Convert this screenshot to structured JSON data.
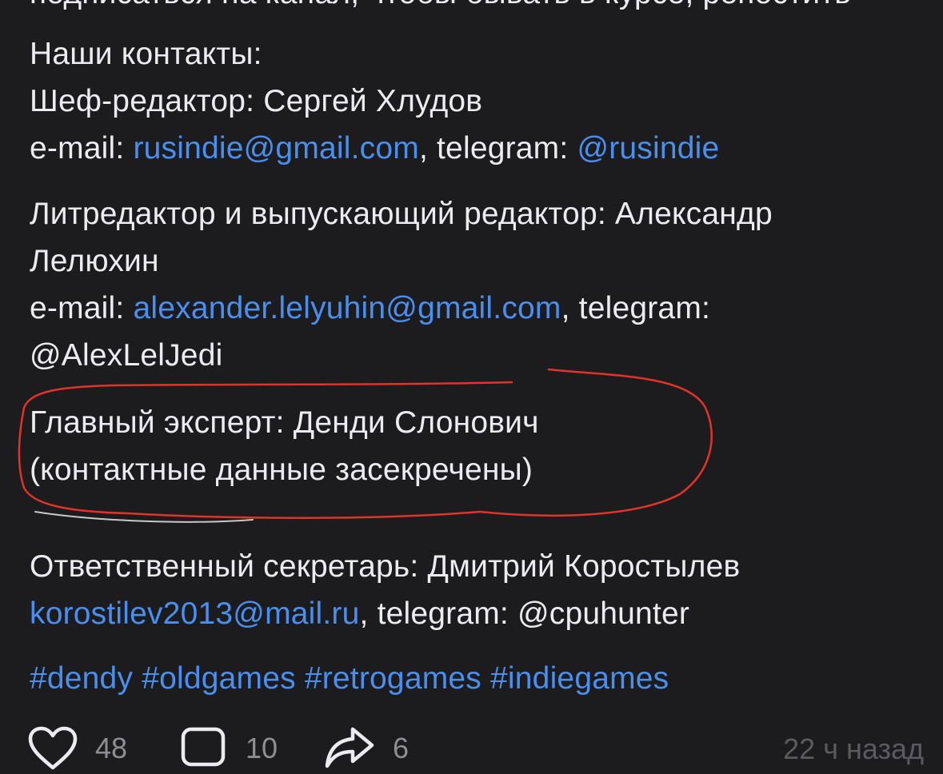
{
  "post": {
    "cut_text": "подписаться на канал, чтобы бывать в курсе, репостить",
    "contacts_heading": "Наши контакты:",
    "chief_editor": "Шеф-редактор: Сергей Хлудов",
    "chief_email_prefix": "e-mail: ",
    "chief_email": "rusindie@gmail.com",
    "chief_tg_prefix": ", telegram: ",
    "chief_tg": "@rusindie",
    "lit_editor_line1": "Литредактор и выпускающий редактор: Александр",
    "lit_editor_line2": "Лелюхин",
    "lit_email_prefix": "e-mail: ",
    "lit_email": "alexander.lelyuhin@gmail.com",
    "lit_tg_prefix": ", telegram:",
    "lit_tg": "@AlexLelJedi",
    "expert_line1": "Главный эксперт: Денди Слонович",
    "expert_line2": "(контактные данные засекречены)",
    "secretary": "Ответственный секретарь: Дмитрий Коростылев",
    "secretary_email": "korostilev2013@mail.ru",
    "secretary_tg_prefix": ", telegram: @cpuhunter",
    "hashtags": [
      "#dendy",
      "#oldgames",
      "#retrogames",
      "#indiegames"
    ]
  },
  "actions": {
    "likes": "48",
    "comments": "10",
    "shares": "6",
    "time": "22 ч назад"
  },
  "colors": {
    "background": "#1c1c1e",
    "text": "#ebebf0",
    "link": "#4a8ff0",
    "annotation": "#e0332b"
  }
}
